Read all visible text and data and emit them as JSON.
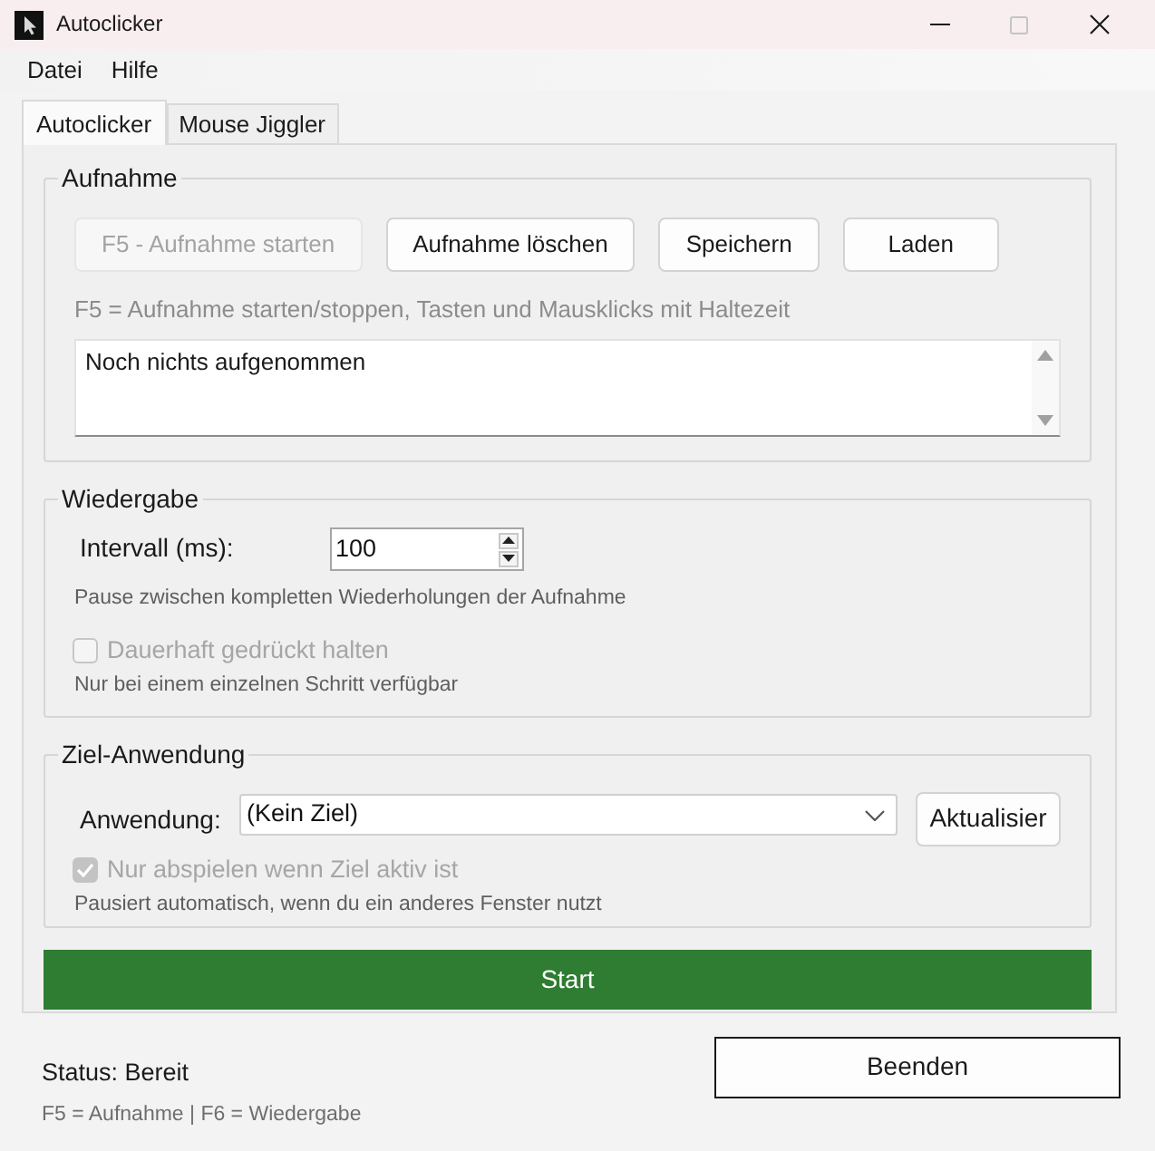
{
  "window": {
    "title": "Autoclicker",
    "controls": [
      {
        "kind": "minimize",
        "disabled": false
      },
      {
        "kind": "maximize",
        "disabled": true
      },
      {
        "kind": "close",
        "disabled": false
      }
    ]
  },
  "menu": [
    {
      "label": "Datei"
    },
    {
      "label": "Hilfe"
    }
  ],
  "tabs": [
    {
      "label": "Autoclicker",
      "selected": true
    },
    {
      "label": "Mouse Jiggler",
      "selected": false
    }
  ],
  "recording": {
    "title": "Aufnahme",
    "buttons": [
      {
        "label": "F5 - Aufnahme starten",
        "disabled": true
      },
      {
        "label": "Aufnahme löschen",
        "disabled": false
      },
      {
        "label": "Speichern",
        "disabled": false
      },
      {
        "label": "Laden",
        "disabled": false
      }
    ],
    "hint": "F5 = Aufnahme starten/stoppen, Tasten und Mausklicks mit Haltezeit",
    "log": "Noch nichts aufgenommen"
  },
  "playback": {
    "title": "Wiedergabe",
    "interval": {
      "label": "Intervall (ms):",
      "value": "100"
    },
    "interval_hint": "Pause zwischen kompletten Wiederholungen der Aufnahme",
    "hold": {
      "label": "Dauerhaft gedrückt halten",
      "checked": false,
      "disabled": true
    },
    "hold_hint": "Nur bei einem einzelnen Schritt verfügbar"
  },
  "target": {
    "title": "Ziel-Anwendung",
    "application": {
      "label": "Anwendung:",
      "value": "(Kein Ziel)"
    },
    "refresh_button": "Aktualisier",
    "only_when_active": {
      "label": "Nur abspielen wenn Ziel aktiv ist",
      "checked": true,
      "disabled": true
    },
    "hint": "Pausiert automatisch, wenn du ein anderes Fenster nutzt"
  },
  "start_button": "Start",
  "status": "Status: Bereit",
  "shortcuts": "F5 = Aufnahme | F6 = Wiedergabe",
  "quit_button": "Beenden"
}
